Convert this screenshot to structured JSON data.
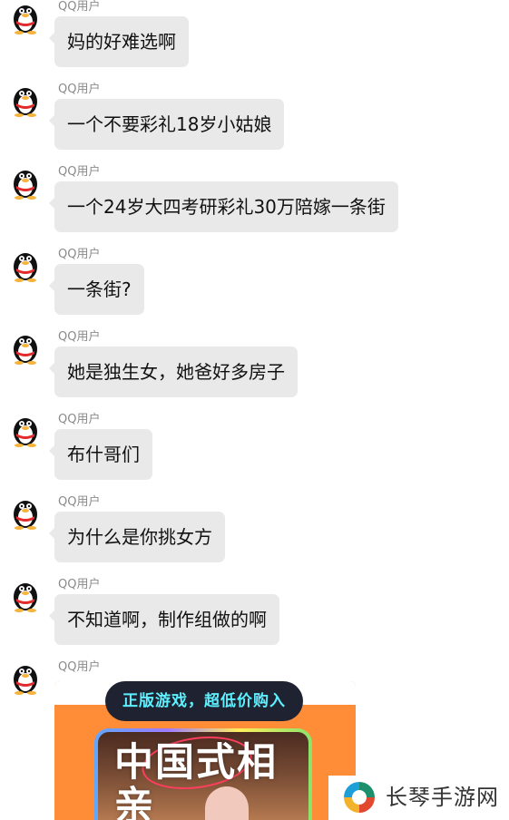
{
  "chat": {
    "messages": [
      {
        "sender": "QQ用户",
        "text": "妈的好难选啊"
      },
      {
        "sender": "QQ用户",
        "text": "一个不要彩礼18岁小姑娘"
      },
      {
        "sender": "QQ用户",
        "text": "一个24岁大四考研彩礼30万陪嫁一条街"
      },
      {
        "sender": "QQ用户",
        "text": "一条街?"
      },
      {
        "sender": "QQ用户",
        "text": "她是独生女，她爸好多房子"
      },
      {
        "sender": "QQ用户",
        "text": "布什哥们"
      },
      {
        "sender": "QQ用户",
        "text": "为什么是你挑女方"
      },
      {
        "sender": "QQ用户",
        "text": "不知道啊，制作组做的啊"
      },
      {
        "sender": "QQ用户"
      }
    ],
    "card": {
      "promo": "正版游戏，超低价购入",
      "title": "中国式相亲"
    }
  },
  "watermark": {
    "text": "长琴手游网"
  },
  "theme": {
    "bubble_color": "#e9e9e9",
    "sender_color": "#8a8a8a",
    "card_color": "#ff8d38"
  }
}
